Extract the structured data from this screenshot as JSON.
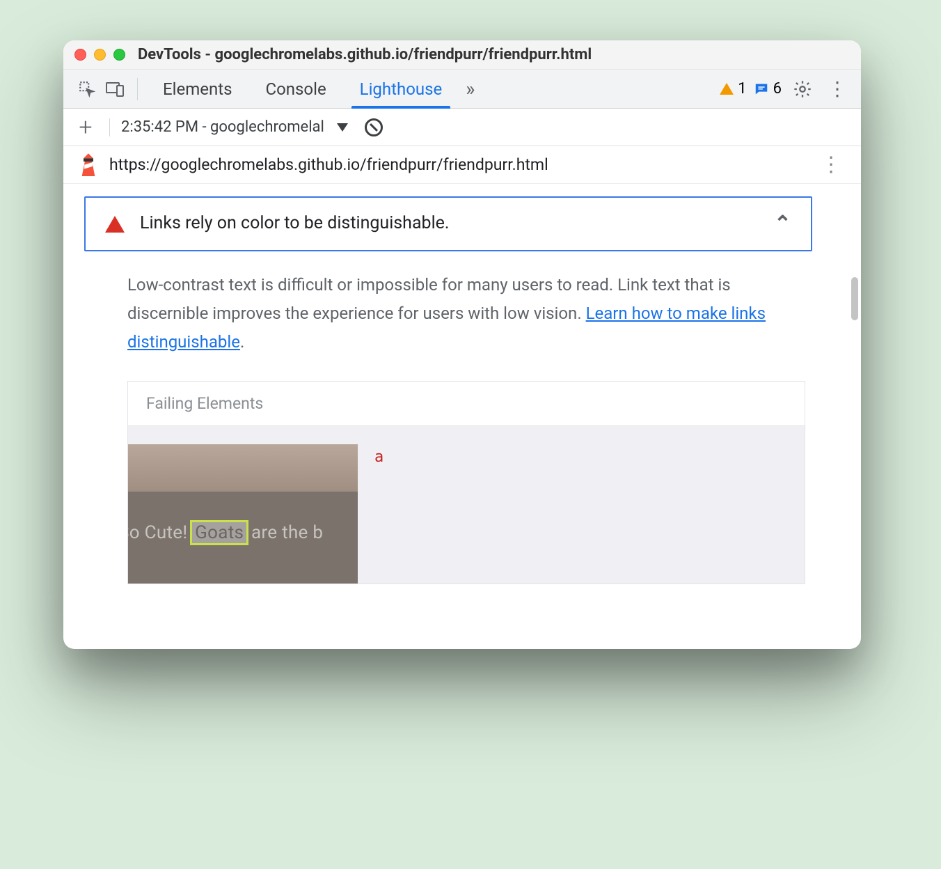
{
  "title": "DevTools - googlechromelabs.github.io/friendpurr/friendpurr.html",
  "tabs": {
    "t0": "Elements",
    "t1": "Console",
    "t2": "Lighthouse"
  },
  "counts": {
    "warnings": "1",
    "messages": "6"
  },
  "session": {
    "label": "2:35:42 PM - googlechromelal"
  },
  "url": "https://googlechromelabs.github.io/friendpurr/friendpurr.html",
  "audit": {
    "title": "Links rely on color to be distinguishable.",
    "desc_pre": "Low-contrast text is difficult or impossible for many users to read. Link text that is discernible improves the experience for users with low vision. ",
    "learn": "Learn how to make links distinguishable",
    "period": "."
  },
  "failing": {
    "header": "Failing Elements",
    "thumb_pre": "So Cute! ",
    "thumb_hl": "Goats",
    "thumb_post": " are the b",
    "tag": "a"
  }
}
